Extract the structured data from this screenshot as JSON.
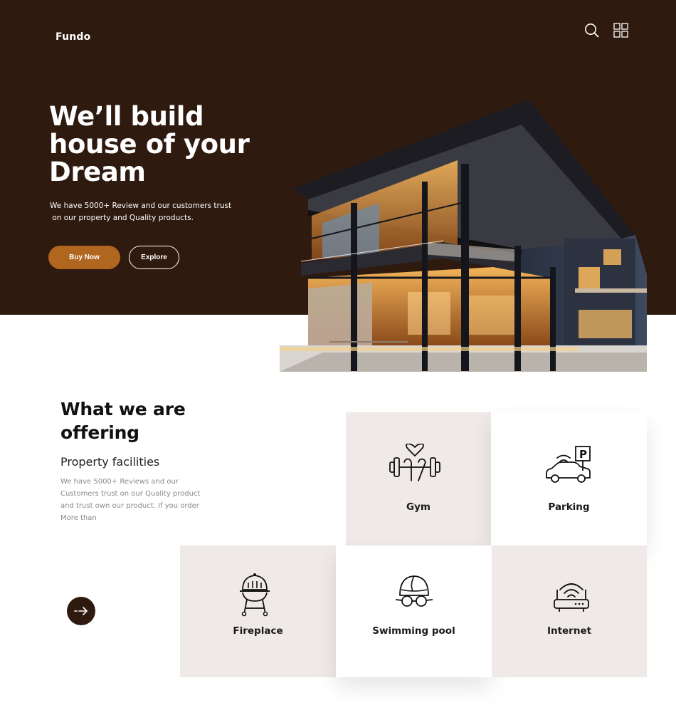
{
  "header": {
    "logo": "Fundo",
    "icons": [
      "search-icon",
      "grid-icon"
    ]
  },
  "hero": {
    "title_line1": "We’ll build",
    "title_line2": "house of your",
    "title_line3": "Dream",
    "subtitle_line1": "We have 5000+ Review and our customers trust",
    "subtitle_line2": "on our property and Quality products.",
    "buy_label": "Buy Now",
    "explore_label": "Explore"
  },
  "offering": {
    "title_line1": "What we are",
    "title_line2": "offering",
    "subtitle": "Property facilities",
    "desc_line1": "We have 5000+ Reviews and our",
    "desc_line2": "Customers trust on our Quality product",
    "desc_line3": "and trust own our product. If you order",
    "desc_line4": "More than",
    "arrow_icon": "arrow-right-icon",
    "facilities": [
      {
        "label": "Gym",
        "icon": "gym-icon"
      },
      {
        "label": "Parking",
        "icon": "parking-icon"
      },
      {
        "label": "Fireplace",
        "icon": "grill-icon"
      },
      {
        "label": "Swimming pool",
        "icon": "swim-cap-icon"
      },
      {
        "label": "Internet",
        "icon": "router-icon"
      }
    ]
  },
  "colors": {
    "hero_bg": "#2f1a10",
    "accent": "#b0661f",
    "tile_grey": "#efe9e8"
  }
}
